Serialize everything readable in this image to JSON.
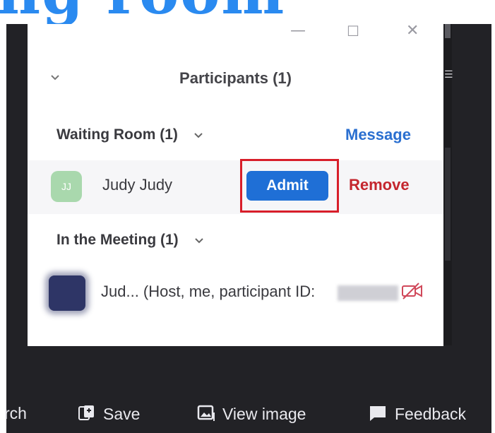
{
  "banner": {
    "text": "ng room"
  },
  "panel": {
    "title": "Participants (1)",
    "window_controls": {
      "minimize": "—",
      "maximize": "☐",
      "close": "✕"
    },
    "waiting_room": {
      "heading": "Waiting Room (1)",
      "message_label": "Message",
      "participant": {
        "initials": "JJ",
        "name": "Judy Judy",
        "admit_label": "Admit",
        "remove_label": "Remove"
      }
    },
    "in_meeting": {
      "heading": "In the Meeting (1)",
      "participant": {
        "name_line": "Jud... (Host, me, participant ID:"
      }
    }
  },
  "bottom_toolbar": {
    "search_fragment": "rch",
    "save_label": "Save",
    "view_image_label": "View image",
    "feedback_label": "Feedback"
  },
  "colors": {
    "accent_blue": "#1f6fd6",
    "link_blue": "#2a6fd0",
    "remove_red": "#c4262e",
    "highlight_box": "#d81e2a",
    "banner_blue": "#2a8af0"
  },
  "icons": {
    "collapse": "chevron-down-icon",
    "camera_off": "video-off-icon",
    "save": "save-icon",
    "view_image": "image-icon",
    "feedback": "feedback-icon"
  }
}
